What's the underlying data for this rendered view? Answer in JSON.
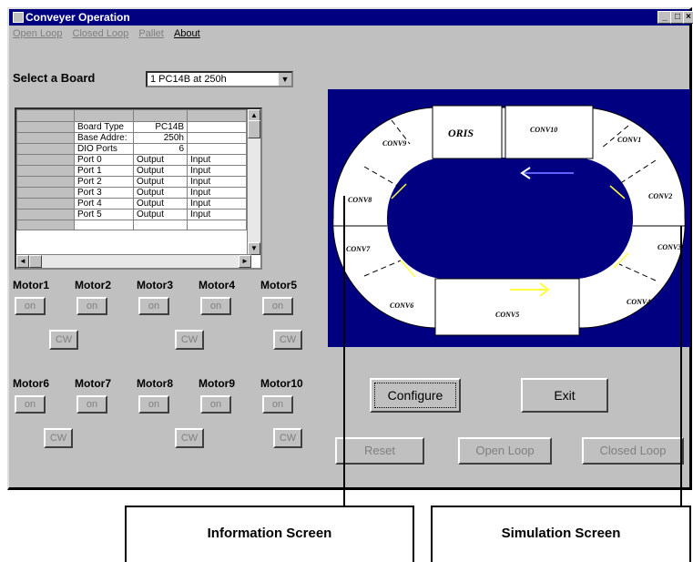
{
  "window": {
    "title": "Conveyer Operation",
    "min": "_",
    "max": "□",
    "close": "×"
  },
  "menu": {
    "open_loop": "Open Loop",
    "closed_loop": "Closed Loop",
    "pallet": "Pallet",
    "about": "About"
  },
  "board": {
    "label": "Select a Board",
    "selected": "1 PC14B at 250h",
    "dropdown": "▼"
  },
  "grid": {
    "rows": [
      [
        "Board Type",
        "PC14B",
        ""
      ],
      [
        "Base Addre:",
        "250h",
        ""
      ],
      [
        "DIO Ports",
        "6",
        ""
      ],
      [
        "Port 0",
        "Output",
        "Input"
      ],
      [
        "Port 1",
        "Output",
        "Input"
      ],
      [
        "Port 2",
        "Output",
        "Input"
      ],
      [
        "Port 3",
        "Output",
        "Input"
      ],
      [
        "Port 4",
        "Output",
        "Input"
      ],
      [
        "Port 5",
        "Output",
        "Input"
      ]
    ],
    "up": "▲",
    "down": "▼",
    "left": "◄",
    "right": "►"
  },
  "motors_row1": {
    "labels": [
      "Motor1",
      "Motor2",
      "Motor3",
      "Motor4",
      "Motor5"
    ],
    "on": "on",
    "cw": "CW"
  },
  "motors_row2": {
    "labels": [
      "Motor6",
      "Motor7",
      "Motor8",
      "Motor9",
      "Motor10"
    ],
    "on": "on",
    "cw": "CW"
  },
  "simulation": {
    "labels": [
      "ORIS",
      "CONV10",
      "CONV1",
      "CONV9",
      "CONV8",
      "CONV2",
      "CONV7",
      "CONV3",
      "CONV6",
      "CONV5",
      "CONV4"
    ],
    "colors": {
      "track": "#ffffff",
      "inner": "#000080",
      "background": "#000080",
      "arrow": "#ffff40",
      "arrow_blue": "#6060ff"
    }
  },
  "buttons": {
    "configure": "Configure",
    "exit": "Exit",
    "reset": "Reset",
    "open_loop": "Open Loop",
    "closed_loop": "Closed Loop"
  },
  "annotations": {
    "info": "Information Screen",
    "sim": "Simulation Screen"
  }
}
